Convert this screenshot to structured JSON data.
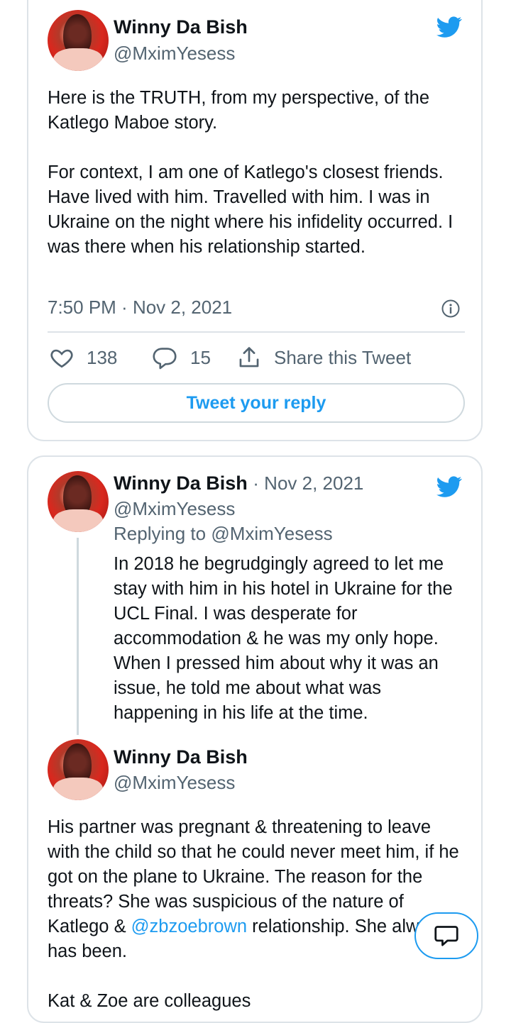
{
  "tweet1": {
    "author_name": "Winny Da Bish",
    "author_handle": "@MximYesess",
    "paragraphs": [
      "Here is the TRUTH, from my perspective, of the Katlego Maboe story.",
      "For context, I am one of Katlego's closest friends. Have lived with him. Travelled with him. I was in Ukraine on the night where his infidelity occurred. I was there when his relationship started."
    ],
    "time": "7:50 PM",
    "date": "Nov 2, 2021",
    "like_count": "138",
    "reply_count": "15",
    "share_label": "Share this Tweet",
    "reply_button_label": "Tweet your reply",
    "icons": {
      "brand": "twitter-bird-icon",
      "info": "info-icon",
      "like": "heart-icon",
      "reply": "comment-icon",
      "share": "share-icon"
    }
  },
  "tweet2": {
    "author_name": "Winny Da Bish",
    "date": "· Nov 2, 2021",
    "author_handle": "@MximYesess",
    "replying_to_label": "Replying to",
    "replying_to_handle": "@MximYesess",
    "text": "In 2018 he begrudgingly agreed to let me stay with him in his hotel in Ukraine for the UCL Final. I was desperate for accommodation & he was my only hope. When I pressed him about why it was an issue, he told me about what was happening in his life at the time."
  },
  "tweet3": {
    "author_name": "Winny Da Bish",
    "author_handle": "@MximYesess",
    "text_before_mention": "His partner was pregnant & threatening to leave with the child so that he could never meet him, if he got on the plane to Ukraine. The reason for the threats? She was suspicious of the nature of Katlego & ",
    "mention": "@zbzoebrown",
    "text_after_mention": " relationship. She always has been.",
    "next_paragraph": "Kat & Zoe are colleagues"
  },
  "colors": {
    "link": "#1d9bf0",
    "muted": "#536471",
    "border": "#dde3e8",
    "text": "#0f1419"
  },
  "compose_fab": {
    "icon": "message-icon"
  }
}
